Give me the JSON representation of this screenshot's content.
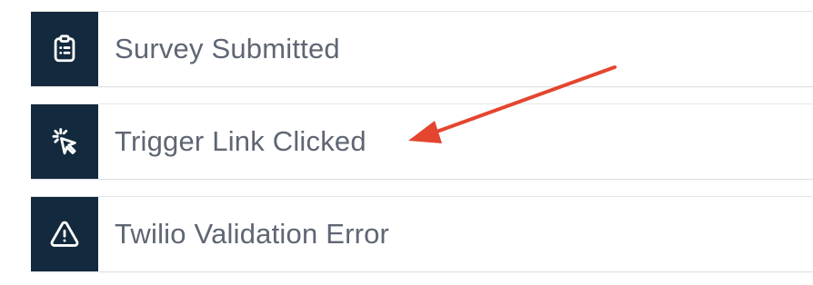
{
  "events": [
    {
      "label": "Survey Submitted",
      "icon": "clipboard-list-icon"
    },
    {
      "label": "Trigger Link Clicked",
      "icon": "cursor-click-icon"
    },
    {
      "label": "Twilio Validation Error",
      "icon": "warning-triangle-icon"
    }
  ],
  "colors": {
    "icon_background": "#13293d",
    "label_text": "#5f6673",
    "annotation_arrow": "#e4452f"
  }
}
